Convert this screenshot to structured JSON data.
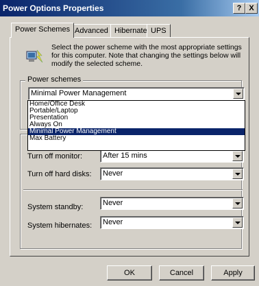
{
  "window": {
    "title": "Power Options Properties",
    "help_btn": "?",
    "close_btn": "X"
  },
  "tabs": [
    {
      "label": "Power Schemes",
      "active": true
    },
    {
      "label": "Advanced",
      "active": false
    },
    {
      "label": "Hibernate",
      "active": false
    },
    {
      "label": "UPS",
      "active": false
    }
  ],
  "description": "Select the power scheme with the most appropriate settings for this computer. Note that changing the settings below will modify the selected scheme.",
  "power_schemes": {
    "legend": "Power schemes",
    "selected": "Minimal Power Management",
    "options": [
      "Home/Office Desk",
      "Portable/Laptop",
      "Presentation",
      "Always On",
      "Minimal Power Management",
      "Max Battery"
    ],
    "highlighted_index": 4
  },
  "settings": {
    "monitor_label": "Turn off monitor:",
    "monitor_value": "After 15 mins",
    "disks_label": "Turn off hard disks:",
    "disks_value": "Never",
    "standby_label": "System standby:",
    "standby_value": "Never",
    "hibernate_label": "System hibernates:",
    "hibernate_value": "Never"
  },
  "buttons": {
    "ok": "OK",
    "cancel": "Cancel",
    "apply": "Apply"
  }
}
